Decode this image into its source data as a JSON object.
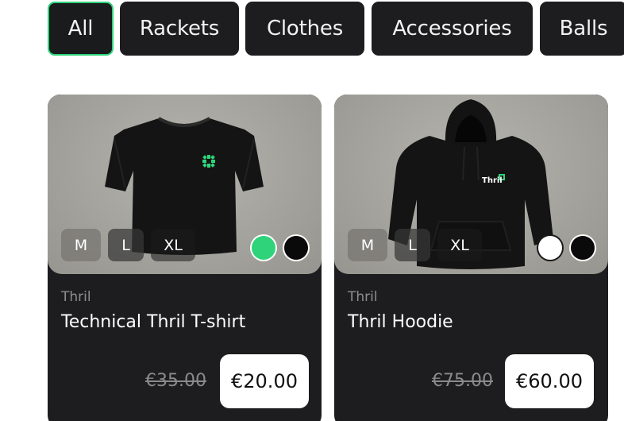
{
  "filters": {
    "tabs": [
      {
        "label": "All",
        "active": true
      },
      {
        "label": "Rackets",
        "active": false
      },
      {
        "label": "Clothes",
        "active": false
      },
      {
        "label": "Accessories",
        "active": false
      },
      {
        "label": "Balls",
        "active": false
      }
    ]
  },
  "products": [
    {
      "brand": "Thril",
      "name": "Technical Thril T-shirt",
      "image_icon": "black-tshirt-image",
      "sizes": [
        "M",
        "L",
        "XL"
      ],
      "colors": [
        "#2fd47a",
        "#0a0a0a"
      ],
      "old_price": "€35.00",
      "price": "€20.00"
    },
    {
      "brand": "Thril",
      "name": "Thril Hoodie",
      "image_icon": "black-hoodie-image",
      "image_text": "Thril",
      "sizes": [
        "M",
        "L",
        "XL"
      ],
      "colors": [
        "#ffffff",
        "#0a0a0a"
      ],
      "old_price": "€75.00",
      "price": "€60.00"
    }
  ],
  "accent_color": "#2fd47a"
}
